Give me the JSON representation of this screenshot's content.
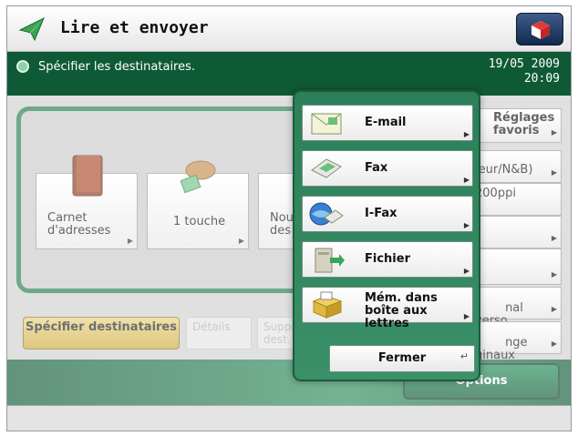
{
  "header": {
    "title": "Lire et envoyer",
    "app_icon": "paper-plane-icon",
    "system_button_icon": "cube-icon"
  },
  "info": {
    "message": "Spécifier les destinataires.",
    "date": "19/05 2009",
    "time": "20:09"
  },
  "destinations": [
    {
      "label": "Carnet d'adresses",
      "icon": "address-book-icon"
    },
    {
      "label": "1 touche",
      "icon": "one-touch-hand-icon"
    },
    {
      "label": "Nou des",
      "icon": "new-destination-icon"
    }
  ],
  "right_panel": {
    "favorites_label": "Réglages favoris",
    "color_label": "leur/N&B)",
    "resolution_label": "200ppi",
    "original_label": "nal\nverso",
    "mixed_label": "nge\nginaux"
  },
  "tabs": {
    "active": "Spécifier destinataires",
    "details": "Détails",
    "delete": "Suppr dest."
  },
  "options_label": "Options",
  "popup": {
    "items": [
      {
        "label": "E-mail",
        "icon": "email-icon"
      },
      {
        "label": "Fax",
        "icon": "fax-icon"
      },
      {
        "label": "I-Fax",
        "icon": "ifax-icon"
      },
      {
        "label": "Fichier",
        "icon": "file-server-icon"
      },
      {
        "label": "Mém. dans boîte aux lettres",
        "icon": "mailbox-icon"
      }
    ],
    "close_label": "Fermer"
  },
  "colors": {
    "accent_green": "#0f5a36",
    "tab_gold": "#d9bf5c"
  }
}
